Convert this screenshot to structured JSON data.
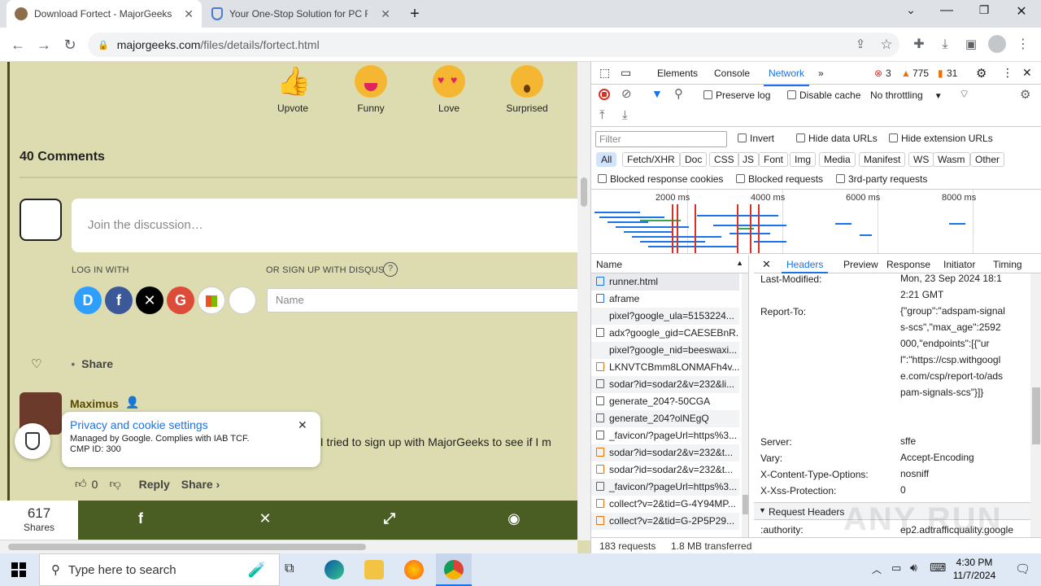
{
  "browser": {
    "tabs": [
      {
        "title": "Download Fortect - MajorGeeks",
        "active": true
      },
      {
        "title": "Your One-Stop Solution for PC R",
        "active": false
      }
    ],
    "url_host": "majorgeeks.com",
    "url_path": "/files/details/fortect.html"
  },
  "page": {
    "reactions": [
      {
        "label": "Upvote"
      },
      {
        "label": "Funny"
      },
      {
        "label": "Love"
      },
      {
        "label": "Surprised"
      }
    ],
    "comments_title": "40 Comments",
    "discussion_placeholder": "Join the discussion…",
    "login_with": "LOG IN WITH",
    "signup_disqus": "OR SIGN UP WITH DISQUS",
    "help_glyph": "?",
    "name_placeholder": "Name",
    "share_label": "Share",
    "comment": {
      "author": "Maximus",
      "text": ". I tried to sign up with MajorGeeks to see if I m",
      "votes": "0",
      "reply": "Reply",
      "share": "Share ›"
    },
    "privacy": {
      "title": "Privacy and cookie settings",
      "line1": "Managed by Google. Complies with IAB TCF.",
      "line2": "CMP ID: 300"
    },
    "sharebar": {
      "count": "617",
      "label": "Shares"
    }
  },
  "devtools": {
    "tabs": [
      "Elements",
      "Console",
      "Network"
    ],
    "active_tab": "Network",
    "errors": "3",
    "warnings": "775",
    "issues": "31",
    "preserve_log": "Preserve log",
    "disable_cache": "Disable cache",
    "throttling": "No throttling",
    "filter_placeholder": "Filter",
    "invert": "Invert",
    "hide_data_urls": "Hide data URLs",
    "hide_ext_urls": "Hide extension URLs",
    "types": [
      "All",
      "Fetch/XHR",
      "Doc",
      "CSS",
      "JS",
      "Font",
      "Img",
      "Media",
      "Manifest",
      "WS",
      "Wasm",
      "Other"
    ],
    "blocked_cookies": "Blocked response cookies",
    "blocked_requests": "Blocked requests",
    "third_party": "3rd-party requests",
    "timeline_ticks": [
      "2000 ms",
      "4000 ms",
      "6000 ms",
      "8000 ms"
    ],
    "name_col": "Name",
    "requests": [
      "runner.html",
      "aframe",
      "pixel?google_ula=5153224...",
      "adx?google_gid=CAESEBnR...",
      "pixel?google_nid=beeswaxi...",
      "LKNVTCBmm8LONMAFh4v...",
      "sodar?id=sodar2&v=232&li...",
      "generate_204?-50CGA",
      "generate_204?olNEgQ",
      "_favicon/?pageUrl=https%3...",
      "sodar?id=sodar2&v=232&t...",
      "sodar?id=sodar2&v=232&t...",
      "_favicon/?pageUrl=https%3...",
      "collect?v=2&tid=G-4Y94MP...",
      "collect?v=2&tid=G-2P5P29..."
    ],
    "status_requests": "183 requests",
    "status_transferred": "1.8 MB transferred",
    "detail_tabs": [
      "Headers",
      "Preview",
      "Response",
      "Initiator",
      "Timing"
    ],
    "headers": {
      "last_modified_key": "Last-Modified:",
      "last_modified_val": "Mon, 23 Sep 2024 18:12:21 GMT",
      "report_to_key": "Report-To:",
      "report_to_val": "{\"group\":\"adspam-signals-scs\",\"max_age\":2592000,\"endpoints\":[{\"url\":\"https://csp.withgoogle.com/csp/report-to/adspam-signals-scs\"}]}",
      "server_key": "Server:",
      "server_val": "sffe",
      "vary_key": "Vary:",
      "vary_val": "Accept-Encoding",
      "xcto_key": "X-Content-Type-Options:",
      "xcto_val": "nosniff",
      "xxss_key": "X-Xss-Protection:",
      "xxss_val": "0",
      "request_headers": "Request Headers",
      "authority_key": ":authority:",
      "authority_val": "ep2.adtrafficquality.google"
    }
  },
  "taskbar": {
    "search_placeholder": "Type here to search",
    "time": "4:30 PM",
    "date": "11/7/2024"
  },
  "watermark": "ANY RUN"
}
